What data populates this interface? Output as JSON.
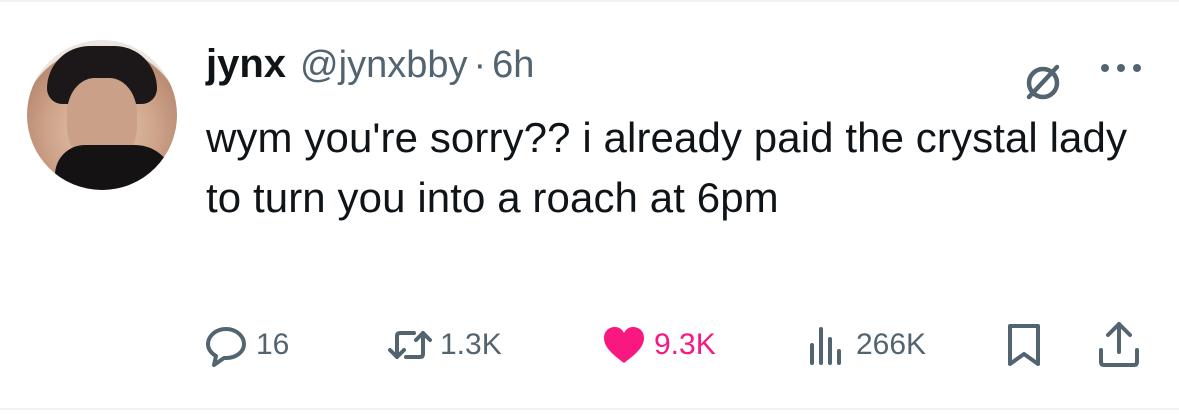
{
  "author": {
    "name": "jynx",
    "handle": "@jynxbby",
    "separator": "·",
    "time": "6h"
  },
  "tweet": {
    "text": "wym you're sorry?? i already paid the crystal lady to turn you into a roach at 6pm"
  },
  "actions": {
    "replies": "16",
    "reposts": "1.3K",
    "likes": "9.3K",
    "views": "266K"
  },
  "icons": {
    "grok": "grok-icon",
    "more": "more-icon",
    "reply": "reply-icon",
    "repost": "repost-icon",
    "like": "heart-icon",
    "views": "views-icon",
    "bookmark": "bookmark-icon",
    "share": "share-icon"
  },
  "colors": {
    "text": "#0f1419",
    "secondary": "#536471",
    "like": "#f91880"
  }
}
